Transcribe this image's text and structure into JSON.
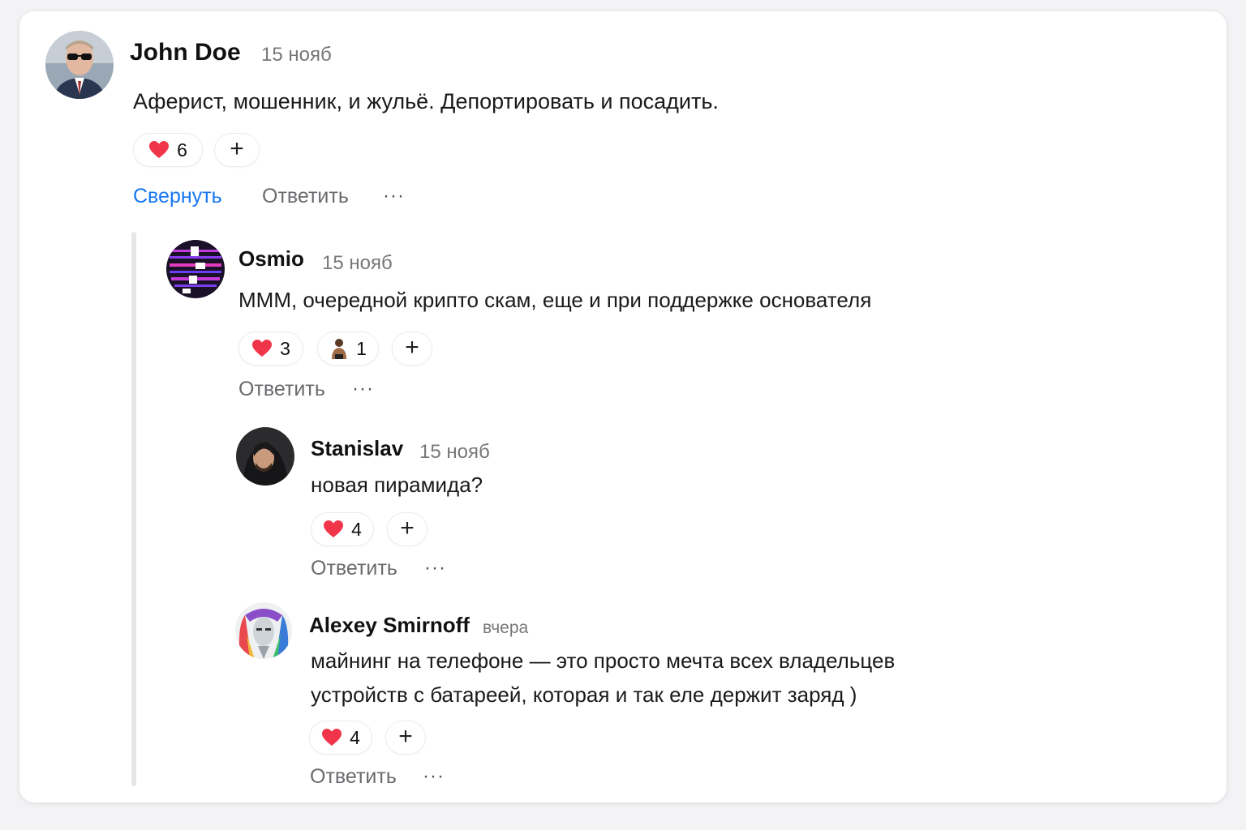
{
  "comments": {
    "c1": {
      "author": "John Doe",
      "time": "15 нояб",
      "text": "Аферист, мошенник, и жульё. Депортировать и посадить.",
      "likes": "6",
      "collapse": "Свернуть",
      "reply": "Ответить",
      "more": "···"
    },
    "c2": {
      "author": "Osmio",
      "time": "15 нояб",
      "text": "МММ, очередной крипто скам, еще и при поддержке основателя",
      "likes": "3",
      "reaction2": "1",
      "reply": "Ответить",
      "more": "···"
    },
    "c3": {
      "author": "Stanislav",
      "time": "15 нояб",
      "text": "новая пирамида?",
      "likes": "4",
      "reply": "Ответить",
      "more": "···"
    },
    "c4": {
      "author": "Alexey Smirnoff",
      "time": "вчера",
      "text_line1": "майнинг на телефоне — это просто мечта всех владельцев",
      "text_line2": "устройств с батареей, которая и так еле держит заряд )",
      "likes": "4",
      "reply": "Ответить",
      "more": "···"
    }
  },
  "add_reaction": "+",
  "colors": {
    "accent": "#1778f2",
    "heart": "#f0354b"
  },
  "icons": [
    "heart-icon",
    "plus-icon",
    "more-icon",
    "person-emoji-icon"
  ]
}
